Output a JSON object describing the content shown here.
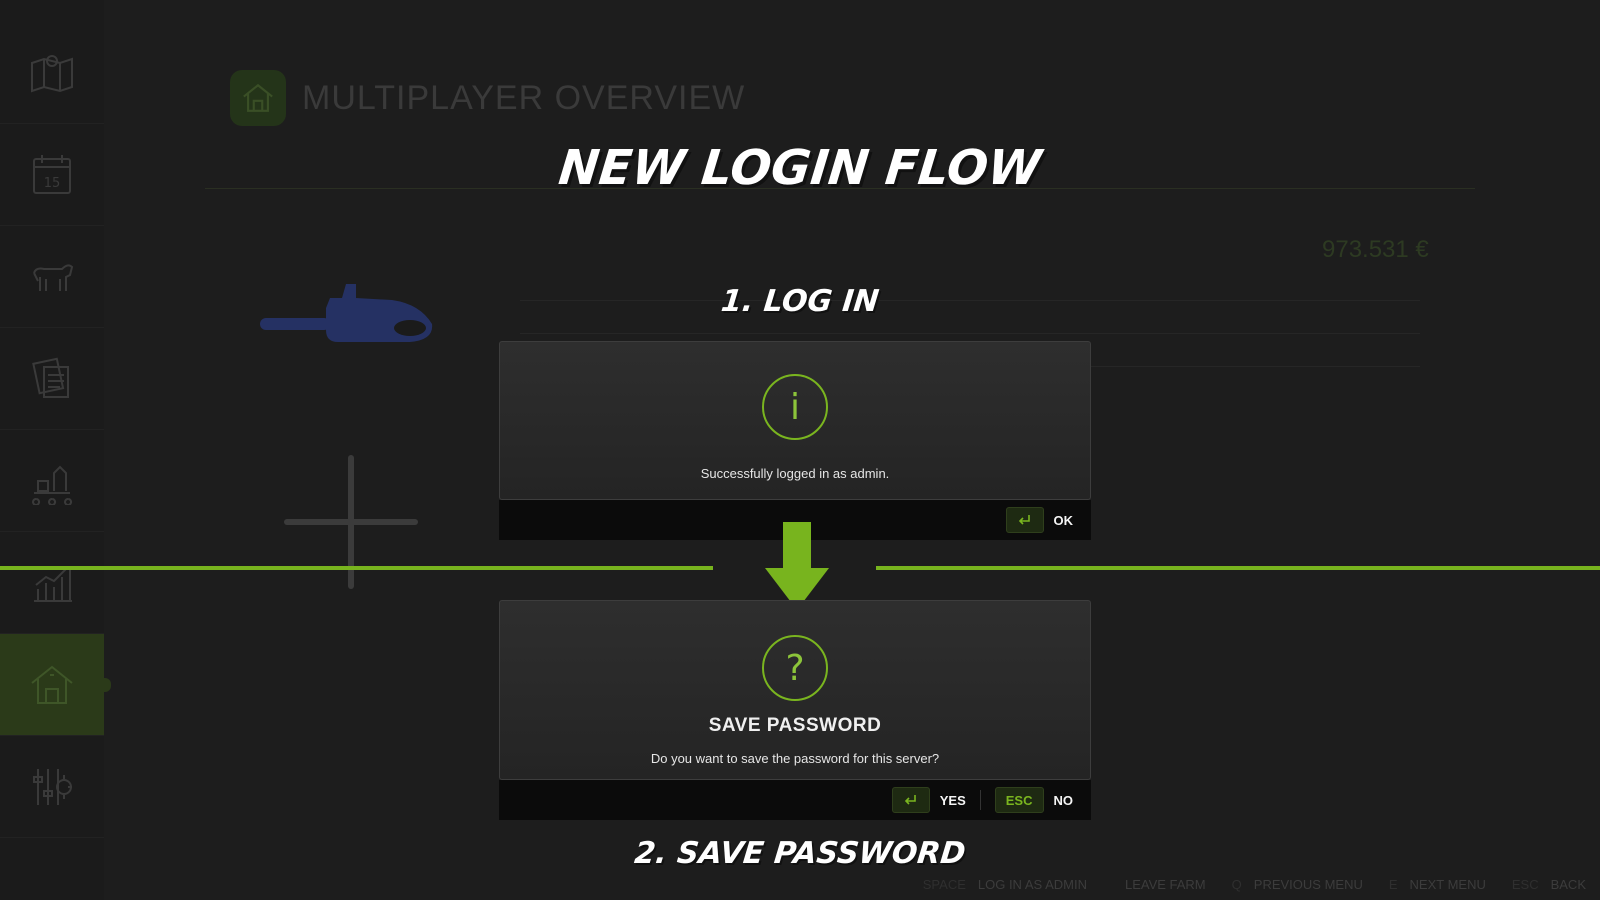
{
  "sidebar": {
    "items": [
      {
        "icon": "map-icon"
      },
      {
        "icon": "calendar-icon",
        "text": "15"
      },
      {
        "icon": "cow-icon"
      },
      {
        "icon": "documents-icon"
      },
      {
        "icon": "production-icon"
      },
      {
        "icon": "statistics-icon"
      },
      {
        "icon": "farm-house-icon",
        "active": true
      },
      {
        "icon": "settings-icon"
      }
    ]
  },
  "background": {
    "title": "MULTIPLAYER OVERVIEW",
    "money": "973.531 €",
    "bottom_hints": [
      {
        "key": "SPACE",
        "label": "LOG IN AS ADMIN"
      },
      {
        "key": "",
        "label": "LEAVE FARM"
      },
      {
        "key": "Q",
        "label": "PREVIOUS MENU"
      },
      {
        "key": "E",
        "label": "NEXT MENU"
      },
      {
        "key": "ESC",
        "label": "BACK"
      }
    ]
  },
  "overlay": {
    "headline": "NEW LOGIN FLOW",
    "step1": "1. LOG IN",
    "step2": "2. SAVE PASSWORD",
    "accent_color": "#78b41e"
  },
  "login_dialog": {
    "icon_glyph": "i",
    "message": "Successfully logged in as admin.",
    "ok_label": "OK"
  },
  "save_dialog": {
    "icon_glyph": "?",
    "title": "SAVE PASSWORD",
    "message": "Do you want to save the password for this server?",
    "yes_label": "YES",
    "no_key": "ESC",
    "no_label": "NO"
  }
}
